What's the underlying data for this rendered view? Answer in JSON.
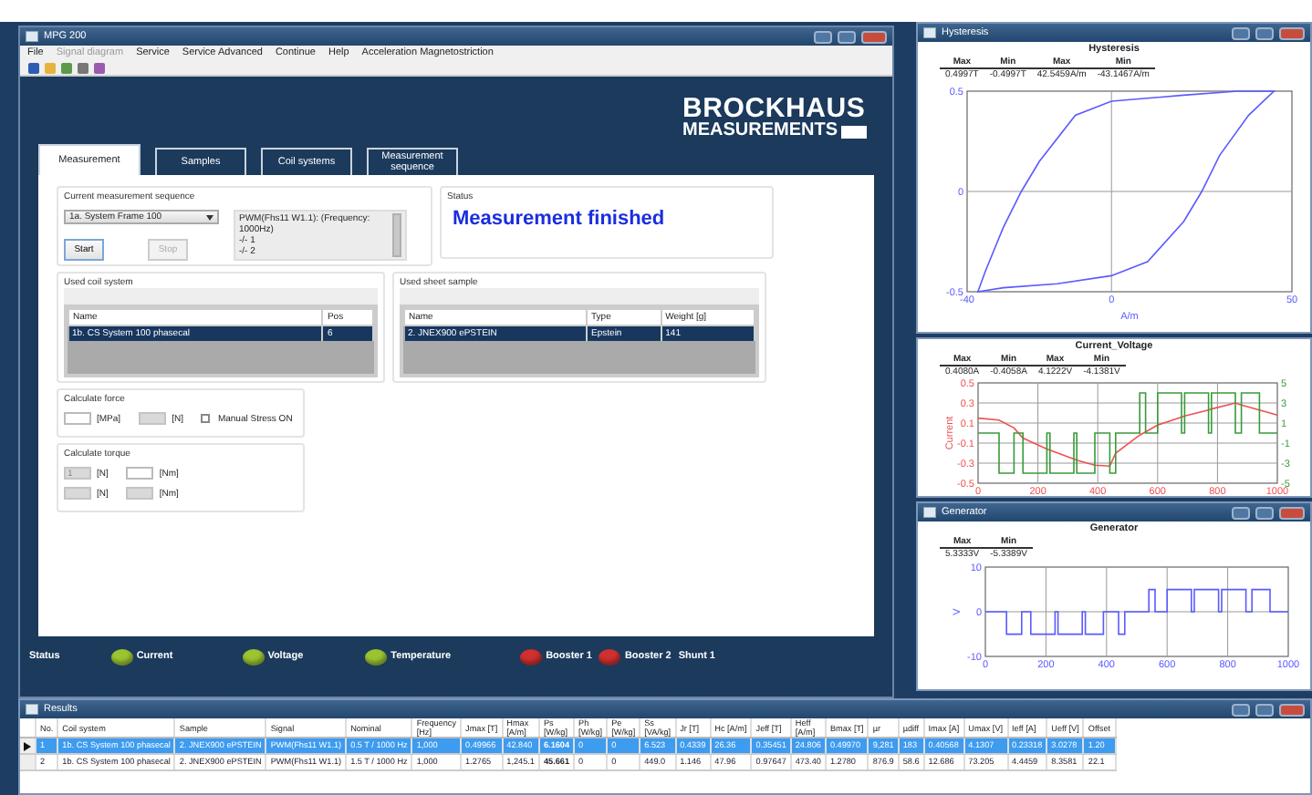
{
  "main_window": {
    "title": "MPG 200",
    "menu": [
      {
        "label": "File",
        "disabled": false
      },
      {
        "label": "Signal diagram",
        "disabled": true
      },
      {
        "label": "Service",
        "disabled": false
      },
      {
        "label": "Service Advanced",
        "disabled": false
      },
      {
        "label": "Continue",
        "disabled": false
      },
      {
        "label": "Help",
        "disabled": false
      },
      {
        "label": "Acceleration Magnetostriction",
        "disabled": false
      }
    ],
    "logo": {
      "line_1": "BROCKHAUS",
      "line_2": "MEASUREMENTS"
    },
    "tabs": [
      {
        "label": "Measurement",
        "selected": true
      },
      {
        "label": "Samples",
        "selected": false
      },
      {
        "label": "Coil systems",
        "selected": false
      },
      {
        "label": "Measurement sequence",
        "selected": false
      }
    ],
    "sequence": {
      "title": "Current measurement sequence",
      "combo_value": "1a. System Frame 100",
      "steps": [
        "PWM(Fhs11 W1.1): (Frequency: 1000Hz)",
        "-/- 1",
        "-/- 2"
      ],
      "buttons": [
        {
          "label": "Start",
          "disabled": false
        },
        {
          "label": "Stop",
          "disabled": true
        }
      ]
    },
    "status": {
      "title": "Status",
      "message": "Measurement finished"
    },
    "coil_system": {
      "title": "Used coil system",
      "columns": [
        "Name",
        "Pos"
      ],
      "rows": [
        {
          "cells": [
            "1b. CS System 100 phasecal",
            "6"
          ],
          "selected": true
        }
      ]
    },
    "sheet_sample": {
      "title": "Used sheet sample",
      "columns": [
        "Name",
        "Type",
        "Weight [g]"
      ],
      "rows": [
        {
          "cells": [
            "2. JNEX900 ePSTEIN",
            "Epstein",
            "141"
          ],
          "selected": true
        }
      ]
    },
    "calculate_force": {
      "title": "Calculate force",
      "fields": [
        {
          "unit": "[MPa]",
          "disabled": false
        },
        {
          "unit": "[N]",
          "disabled": true
        }
      ],
      "checkbox": {
        "label": "Manual Stress ON",
        "checked": false
      }
    },
    "calculate_torque": {
      "title": "Calculate torque",
      "fields": [
        {
          "value": "1",
          "unit": "[N]",
          "disabled": true
        },
        {
          "unit": "[Nm]",
          "disabled": false
        },
        {
          "unit": "[N]",
          "disabled": true
        },
        {
          "unit": "[Nm]",
          "disabled": true
        }
      ]
    },
    "status_bar": {
      "label": "Status",
      "indicators": [
        {
          "label": "Current",
          "color": "#9cc431"
        },
        {
          "label": "Voltage",
          "color": "#9cc431"
        },
        {
          "label": "Temperature",
          "color": "#9cc431"
        },
        {
          "label": "Booster 1",
          "color": "#d03030"
        },
        {
          "label": "Booster 2",
          "color": "#d03030"
        },
        {
          "label": "Shunt 1"
        }
      ]
    }
  },
  "hysteresis": {
    "title": "Hysteresis",
    "chart_title": "Hysteresis",
    "stats": [
      {
        "label": "Max",
        "value": "0.4997T"
      },
      {
        "label": "Min",
        "value": "-0.4997T"
      },
      {
        "label": "Max",
        "value": "42.5459A/m"
      },
      {
        "label": "Min",
        "value": "-43.1467A/m"
      }
    ],
    "chart_data": {
      "type": "line",
      "grid": true,
      "xlabel": "A/m",
      "xlim": [
        -40,
        50
      ],
      "ylim": [
        -0.5,
        0.5
      ],
      "xticks": [
        -40,
        0,
        50
      ],
      "yticks": [
        -0.5,
        0,
        0.5
      ]
    }
  },
  "current_voltage": {
    "chart_title": "Current_Voltage",
    "stats": [
      {
        "label": "Max",
        "value": "0.4080A"
      },
      {
        "label": "Min",
        "value": "-0.4058A"
      },
      {
        "label": "Max",
        "value": "4.1222V"
      },
      {
        "label": "Min",
        "value": "-4.1381V"
      }
    ],
    "chart_data": {
      "type": "line",
      "grid": true,
      "ylabel": "Current",
      "xlim": [
        0,
        1000
      ],
      "ylim": [
        -0.5,
        0.5
      ],
      "y2lim": [
        -5,
        5
      ],
      "xticks": [
        0,
        200,
        400,
        600,
        800,
        1000
      ],
      "yticks": [
        -0.5,
        -0.3,
        -0.1,
        0.1,
        0.3,
        0.5
      ],
      "y2ticks": [
        -5,
        -3,
        -1,
        1,
        3,
        5
      ],
      "x": [
        0,
        70,
        70,
        120,
        120,
        150,
        150,
        230,
        230,
        240,
        240,
        320,
        320,
        330,
        330,
        390,
        390,
        440,
        440,
        460,
        460,
        540,
        540,
        560,
        560,
        600,
        600,
        680,
        680,
        690,
        690,
        770,
        770,
        780,
        780,
        860,
        860,
        880,
        880,
        940,
        940,
        1000
      ],
      "series": [
        {
          "color": "#f05050",
          "values": [
            0.15,
            0.13,
            0.13,
            0.05,
            0.05,
            -0.05,
            -0.05,
            -0.16,
            -0.16,
            -0.17,
            -0.17,
            -0.26,
            -0.26,
            -0.27,
            -0.27,
            -0.32,
            -0.32,
            -0.33,
            -0.33,
            -0.2,
            -0.2,
            -0.02,
            -0.02,
            0.01,
            0.01,
            0.08,
            0.08,
            0.16,
            0.16,
            0.17,
            0.17,
            0.23,
            0.23,
            0.24,
            0.24,
            0.3,
            0.3,
            0.28,
            0.28,
            0.23,
            0.23,
            0.18
          ]
        },
        {
          "color": "#3a9a3a",
          "axis": "y2",
          "values": [
            0,
            0,
            -4,
            -4,
            0,
            0,
            -4,
            -4,
            0,
            0,
            -4,
            -4,
            0,
            0,
            -4,
            -4,
            0,
            0,
            -4,
            -4,
            0,
            0,
            4,
            4,
            0,
            0,
            4,
            4,
            0,
            0,
            4,
            4,
            0,
            0,
            4,
            4,
            0,
            0,
            4,
            4,
            0,
            0
          ]
        }
      ]
    }
  },
  "generator": {
    "title": "Generator",
    "chart_title": "Generator",
    "stats": [
      {
        "label": "Max",
        "value": "5.3333V"
      },
      {
        "label": "Min",
        "value": "-5.3389V"
      }
    ],
    "chart_data": {
      "type": "line",
      "grid": true,
      "ylabel": "V",
      "xlim": [
        0,
        1000
      ],
      "ylim": [
        -10,
        10
      ],
      "xticks": [
        0,
        200,
        400,
        600,
        800,
        1000
      ],
      "yticks": [
        -10,
        0,
        10
      ],
      "x": [
        0,
        70,
        70,
        120,
        120,
        150,
        150,
        230,
        230,
        240,
        240,
        320,
        320,
        330,
        330,
        390,
        390,
        440,
        440,
        460,
        460,
        540,
        540,
        560,
        560,
        600,
        600,
        680,
        680,
        690,
        690,
        770,
        770,
        780,
        780,
        860,
        860,
        880,
        880,
        940,
        940,
        1000
      ],
      "series": [
        {
          "color": "#5a5aff",
          "values": [
            0,
            0,
            -5,
            -5,
            0,
            0,
            -5,
            -5,
            0,
            0,
            -5,
            -5,
            0,
            0,
            -5,
            -5,
            0,
            0,
            -5,
            -5,
            0,
            0,
            5,
            5,
            0,
            0,
            5,
            5,
            0,
            0,
            5,
            5,
            0,
            0,
            5,
            5,
            0,
            0,
            5,
            5,
            0,
            0
          ]
        }
      ]
    }
  },
  "results": {
    "title": "Results",
    "columns": [
      {
        "label": "No."
      },
      {
        "label": "Coil system"
      },
      {
        "label": "Sample"
      },
      {
        "label": "Signal"
      },
      {
        "label": "Nominal"
      },
      {
        "label": "Frequency",
        "unit": "[Hz]"
      },
      {
        "label": "Jmax [T]"
      },
      {
        "label": "Hmax",
        "unit": "[A/m]"
      },
      {
        "label": "Ps",
        "unit": "[W/kg]",
        "emphasized": true
      },
      {
        "label": "Ph",
        "unit": "[W/kg]"
      },
      {
        "label": "Pe",
        "unit": "[W/kg]"
      },
      {
        "label": "Ss",
        "unit": "[VA/kg]"
      },
      {
        "label": "Jr [T]"
      },
      {
        "label": "Hc [A/m]"
      },
      {
        "label": "Jeff [T]"
      },
      {
        "label": "Heff",
        "unit": "[A/m]"
      },
      {
        "label": "Bmax [T]"
      },
      {
        "label": "µr"
      },
      {
        "label": "µdiff"
      },
      {
        "label": "Imax [A]"
      },
      {
        "label": "Umax [V]"
      },
      {
        "label": "Ieff [A]"
      },
      {
        "label": "Ueff [V]"
      },
      {
        "label": "Offset"
      }
    ],
    "rows": [
      {
        "selected": true,
        "current": true,
        "cells": [
          "1",
          "1b. CS System 100 phasecal",
          "2. JNEX900 ePSTEIN",
          "PWM(Fhs11 W1.1)",
          "0.5 T / 1000 Hz",
          "1,000",
          "0.49966",
          "42.840",
          "6.1604",
          "0",
          "0",
          "6.523",
          "0.4339",
          "26.36",
          "0.35451",
          "24.806",
          "0.49970",
          "9,281",
          "183",
          "0.40568",
          "4.1307",
          "0.23318",
          "3.0278",
          "1.20"
        ]
      },
      {
        "selected": false,
        "current": false,
        "cells": [
          "2",
          "1b. CS System 100 phasecal",
          "2. JNEX900 ePSTEIN",
          "PWM(Fhs11 W1.1)",
          "1.5 T / 1000 Hz",
          "1,000",
          "1.2765",
          "1,245.1",
          "45.661",
          "0",
          "0",
          "449.0",
          "1.146",
          "47.96",
          "0.97647",
          "473.40",
          "1.2780",
          "876.9",
          "58.6",
          "12.686",
          "73.205",
          "4.4459",
          "8.3581",
          "22.1"
        ]
      }
    ]
  }
}
